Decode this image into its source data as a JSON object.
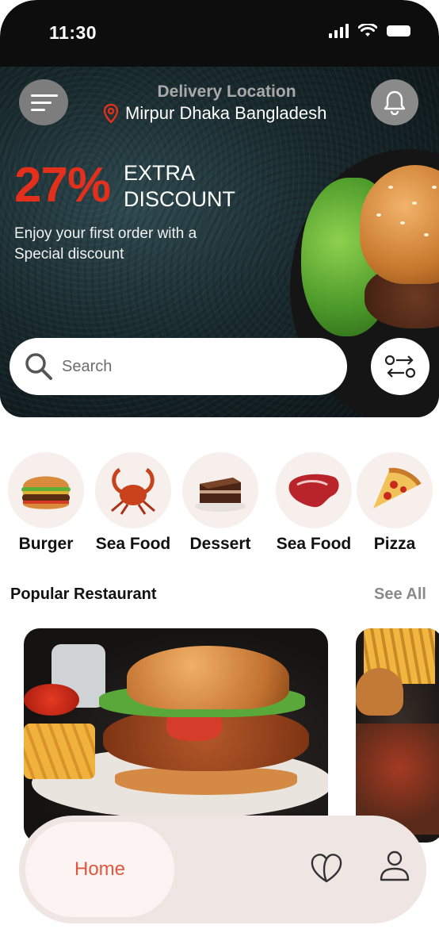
{
  "status_bar": {
    "time": "11:30"
  },
  "header": {
    "location_label": "Delivery Location",
    "location_value": "Mirpur Dhaka Bangladesh",
    "menu_icon": "menu-icon",
    "notification_icon": "bell-icon"
  },
  "promo": {
    "percent": "27%",
    "title_line1": "EXTRA",
    "title_line2": "DISCOUNT",
    "subtitle_line1": "Enjoy your first order with a",
    "subtitle_line2": "Special discount"
  },
  "search": {
    "placeholder": "Search",
    "filter_icon": "filter-icon"
  },
  "categories": [
    {
      "label": "Burger"
    },
    {
      "label": "Sea Food"
    },
    {
      "label": "Dessert"
    },
    {
      "label": "Sea Food"
    },
    {
      "label": "Pizza"
    }
  ],
  "popular": {
    "title": "Popular Restaurant",
    "see_all": "See All"
  },
  "bottom_nav": {
    "home": "Home"
  },
  "colors": {
    "accent": "#e2301c",
    "nav_active": "#e0573f",
    "nav_bg": "#efe5e2",
    "chip_bg": "#f7efec"
  }
}
